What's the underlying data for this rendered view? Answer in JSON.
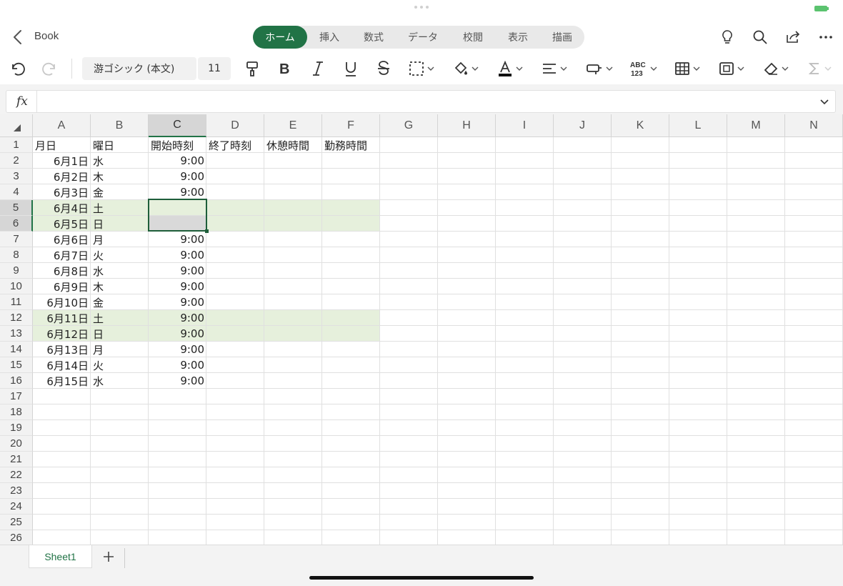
{
  "header": {
    "back_label": "Book",
    "tabs": [
      {
        "label": "ホーム",
        "active": true
      },
      {
        "label": "挿入"
      },
      {
        "label": "数式"
      },
      {
        "label": "データ"
      },
      {
        "label": "校閲"
      },
      {
        "label": "表示"
      },
      {
        "label": "描画"
      }
    ],
    "icons": [
      "lightbulb-icon",
      "search-icon",
      "share-icon",
      "more-icon"
    ]
  },
  "toolbar": {
    "font_name": "游ゴシック (本文)",
    "font_size": "11",
    "icons": [
      "undo-icon",
      "redo-icon",
      "format-painter-icon",
      "bold-icon",
      "italic-icon",
      "underline-icon",
      "strikethrough-icon",
      "borders-icon",
      "fill-color-icon",
      "font-color-icon",
      "align-icon",
      "wrap-icon",
      "number-format-icon",
      "table-icon",
      "cell-style-icon",
      "clear-icon",
      "sum-icon"
    ],
    "number_format_label": "ABC 123"
  },
  "formula_bar": {
    "fx_label": "fx",
    "value": ""
  },
  "sheet": {
    "columns": [
      "A",
      "B",
      "C",
      "D",
      "E",
      "F",
      "G",
      "H",
      "I",
      "J",
      "K",
      "L",
      "M",
      "N"
    ],
    "selected_column": "C",
    "selected_rows": [
      5,
      6
    ],
    "rows": [
      "1",
      "2",
      "3",
      "4",
      "5",
      "6",
      "7",
      "8",
      "9",
      "10",
      "11",
      "12",
      "13",
      "14",
      "15",
      "16",
      "17",
      "18",
      "19",
      "20",
      "21",
      "22",
      "23",
      "24",
      "25",
      "26"
    ],
    "headers": [
      "月日",
      "曜日",
      "開始時刻",
      "終了時刻",
      "休憩時間",
      "勤務時間"
    ],
    "data": [
      {
        "date": "6月1日",
        "day": "水",
        "start": "9:00"
      },
      {
        "date": "6月2日",
        "day": "木",
        "start": "9:00"
      },
      {
        "date": "6月3日",
        "day": "金",
        "start": "9:00"
      },
      {
        "date": "6月4日",
        "day": "土",
        "start": ""
      },
      {
        "date": "6月5日",
        "day": "日",
        "start": ""
      },
      {
        "date": "6月6日",
        "day": "月",
        "start": "9:00"
      },
      {
        "date": "6月7日",
        "day": "火",
        "start": "9:00"
      },
      {
        "date": "6月8日",
        "day": "水",
        "start": "9:00"
      },
      {
        "date": "6月9日",
        "day": "木",
        "start": "9:00"
      },
      {
        "date": "6月10日",
        "day": "金",
        "start": "9:00"
      },
      {
        "date": "6月11日",
        "day": "土",
        "start": "9:00"
      },
      {
        "date": "6月12日",
        "day": "日",
        "start": "9:00"
      },
      {
        "date": "6月13日",
        "day": "月",
        "start": "9:00"
      },
      {
        "date": "6月14日",
        "day": "火",
        "start": "9:00"
      },
      {
        "date": "6月15日",
        "day": "水",
        "start": "9:00"
      }
    ],
    "weekend_highlight_color": "#e6f0dc",
    "accent_color": "#217346"
  },
  "sheet_tabs": {
    "tabs": [
      "Sheet1"
    ],
    "add_label": "+"
  }
}
